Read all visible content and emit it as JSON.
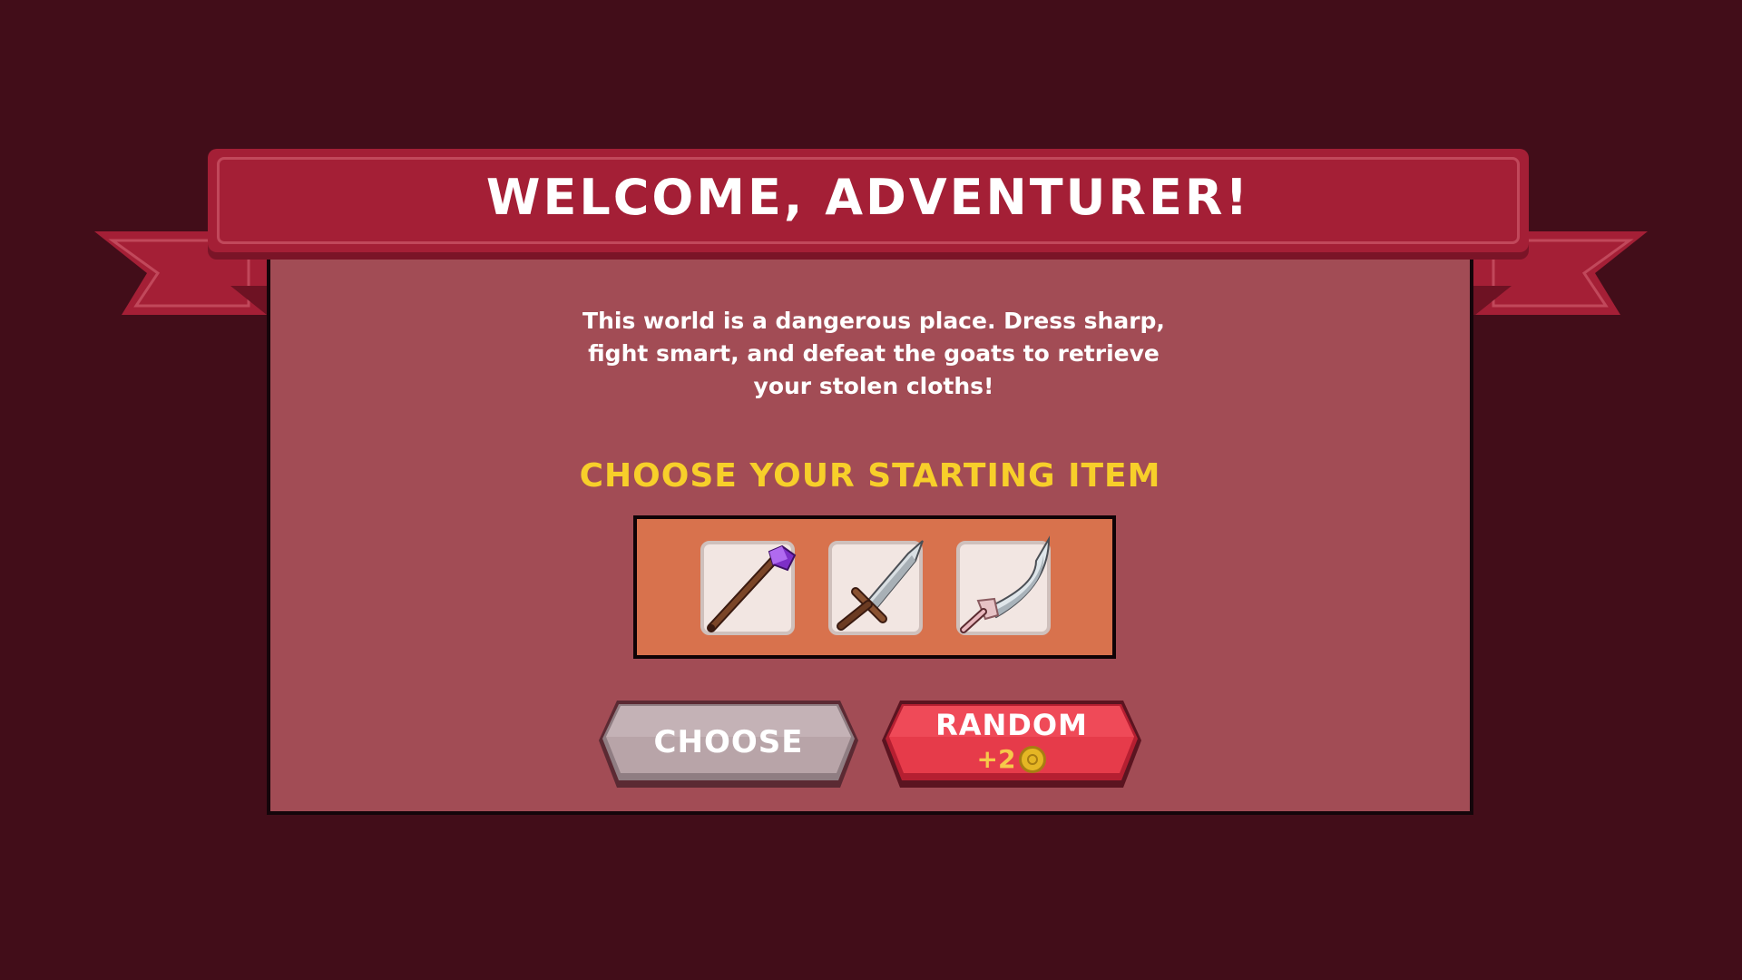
{
  "banner": {
    "title": "WELCOME, ADVENTURER!"
  },
  "panel": {
    "description": "This world is a dangerous place. Dress sharp, fight smart, and defeat the goats to retrieve your stolen cloths!",
    "choose_heading": "CHOOSE YOUR STARTING ITEM"
  },
  "items": [
    {
      "icon": "magic-staff-icon"
    },
    {
      "icon": "sword-icon"
    },
    {
      "icon": "curved-blade-icon"
    }
  ],
  "buttons": {
    "choose_label": "CHOOSE",
    "random_label": "RANDOM",
    "random_cost": "+2",
    "random_cost_icon": "coin-icon"
  },
  "colors": {
    "background": "#420d19",
    "banner": "#a41f36",
    "panel": "#a24c55",
    "heading": "#f7cf2a",
    "items_box": "#d8724d",
    "choose_button": "#b8a4a8",
    "random_button": "#e63b4a"
  }
}
